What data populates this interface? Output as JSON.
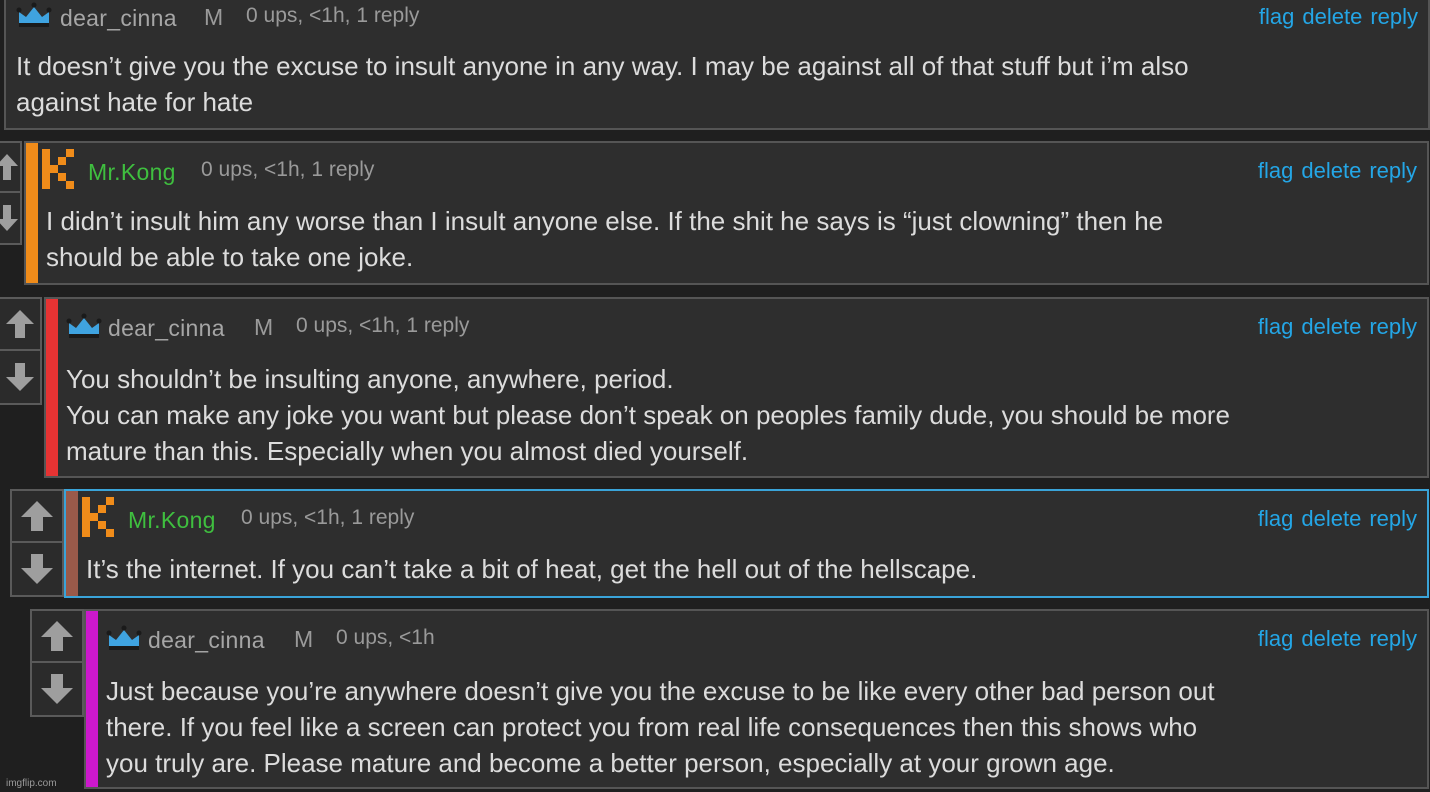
{
  "colors": {
    "background": "#1f1f1f",
    "comment_bg": "#2e2e2e",
    "link": "#24a6e6",
    "meta": "#9a9a9a",
    "user_green": "#3fbf3f",
    "depth_orange": "#f08c1a",
    "depth_red": "#e63333",
    "depth_brown": "#9a5a4a",
    "depth_magenta": "#cc18cc",
    "active_border": "#3aa4d9"
  },
  "actions": {
    "flag": "flag",
    "delete": "delete",
    "reply": "reply"
  },
  "comments": [
    {
      "username": "dear_cinna",
      "gender": "M",
      "meta": "0 ups, <1h, 1 reply",
      "avatar": "crown-icon",
      "lines": [
        "It doesn’t give you the excuse to insult anyone in any way. I may be against all of that stuff but i’m also",
        "against hate for hate"
      ]
    },
    {
      "username": "Mr.Kong",
      "meta": "0 ups, <1h, 1 reply",
      "avatar": "k-letter-icon",
      "lines": [
        "I didn’t insult him any worse than I insult anyone else. If the shit he says is “just clowning” then he",
        "should be able to take one joke."
      ]
    },
    {
      "username": "dear_cinna",
      "gender": "M",
      "meta": "0 ups, <1h, 1 reply",
      "avatar": "crown-icon",
      "lines": [
        "You shouldn’t be insulting anyone, anywhere, period.",
        "You can make any joke you want but please don’t speak on peoples family dude, you should be more",
        "mature than this. Especially when you almost died yourself."
      ]
    },
    {
      "username": "Mr.Kong",
      "meta": "0 ups, <1h, 1 reply",
      "avatar": "k-letter-icon",
      "lines": [
        "It’s the internet. If you can’t take a bit of heat, get the hell out of the hellscape."
      ]
    },
    {
      "username": "dear_cinna",
      "gender": "M",
      "meta": "0 ups, <1h",
      "avatar": "crown-icon",
      "lines": [
        "Just because you’re anywhere doesn’t give you the excuse to be like every other bad person out",
        "there. If you feel like a screen can protect you from real life consequences then this shows who",
        "you truly are. Please mature and become a better person, especially at your grown age."
      ]
    }
  ],
  "watermark": "imgflip.com"
}
